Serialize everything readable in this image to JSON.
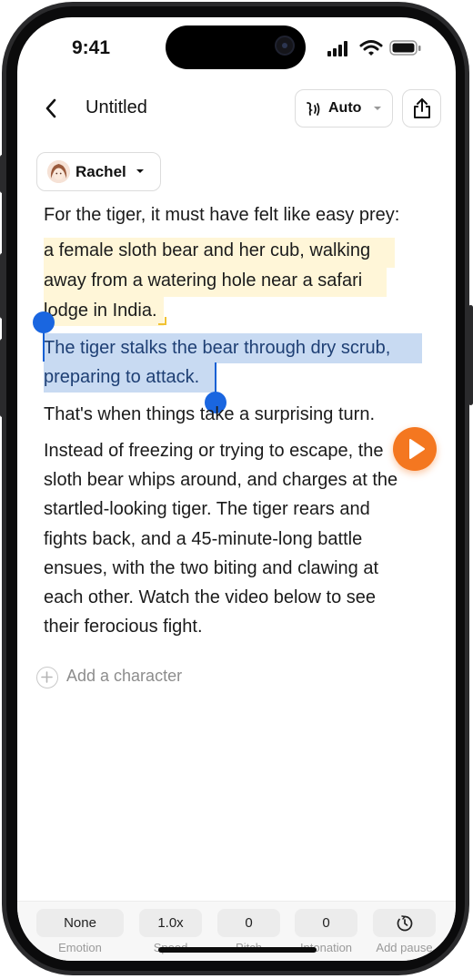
{
  "status_bar": {
    "time": "9:41"
  },
  "header": {
    "title": "Untitled",
    "voice_mode": "Auto"
  },
  "character": {
    "name": "Rachel"
  },
  "content": {
    "intro": "For the tiger, it must have felt like easy prey:",
    "highlight_line1": "a female sloth bear and her cub, walking",
    "highlight_line2": "away from a watering hole near a safari",
    "highlight_line3": "lodge in India.",
    "selected_line1": "The tiger stalks the bear through dry scrub,",
    "selected_line2": "preparing to attack.",
    "turn": "That's when things take a surprising turn.",
    "body_lines": [
      "Instead of freezing or trying to escape, the",
      "sloth bear whips around, and charges at the",
      "startled-looking tiger. The tiger rears and",
      "fights back, and a 45-minute-long battle",
      "ensues, with the two biting and clawing at",
      "each other. Watch the video below to see",
      "their ferocious fight."
    ]
  },
  "add_character_label": "Add a character",
  "controls": [
    {
      "value": "None",
      "label": "Emotion"
    },
    {
      "value": "1.0x",
      "label": "Speed"
    },
    {
      "value": "0",
      "label": "Pitch"
    },
    {
      "value": "0",
      "label": "Intonation"
    },
    {
      "value": "",
      "label": "Add pause"
    }
  ],
  "colors": {
    "accent": "#f47720",
    "selection": "#1a66e0",
    "highlight": "#fff6d8"
  }
}
